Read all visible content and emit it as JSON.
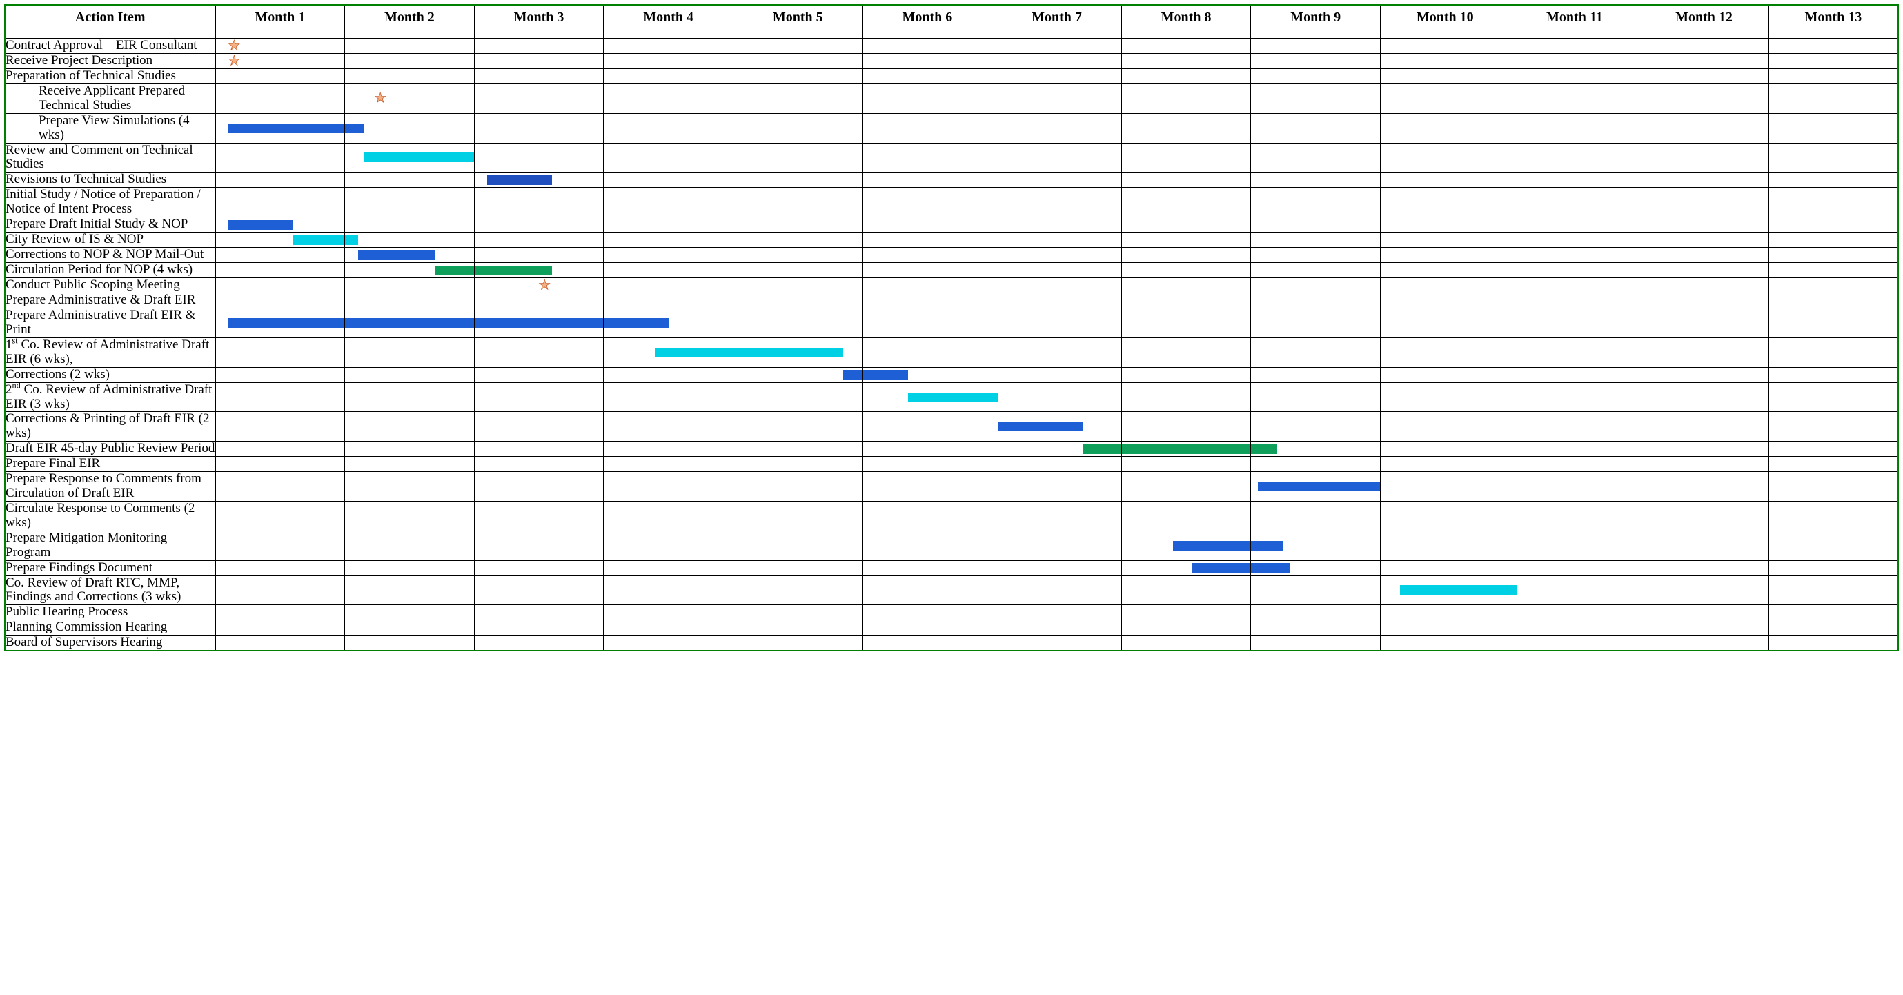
{
  "headers": {
    "action": "Action Item",
    "months": [
      "Month 1",
      "Month 2",
      "Month 3",
      "Month 4",
      "Month 5",
      "Month 6",
      "Month 7",
      "Month 8",
      "Month 9",
      "Month 10",
      "Month 11",
      "Month 12",
      "Month 13"
    ]
  },
  "rows": [
    {
      "label": "Contract Approval – EIR Consultant",
      "indent": false
    },
    {
      "label": "Receive Project Description",
      "indent": false
    },
    {
      "label": "Preparation of Technical Studies",
      "indent": false
    },
    {
      "label": "Receive Applicant Prepared Technical Studies",
      "indent": true
    },
    {
      "label": "Prepare View Simulations (4 wks)",
      "indent": true
    },
    {
      "label": "Review and Comment on Technical Studies",
      "indent": false
    },
    {
      "label": "Revisions to Technical Studies",
      "indent": false
    },
    {
      "label": "Initial Study / Notice of Preparation / Notice of Intent Process",
      "indent": false
    },
    {
      "label": "Prepare Draft Initial Study & NOP",
      "indent": false
    },
    {
      "label": "City Review of IS & NOP",
      "indent": false
    },
    {
      "label": "Corrections to NOP & NOP Mail-Out",
      "indent": false
    },
    {
      "label": "Circulation Period for NOP  (4 wks)",
      "indent": false
    },
    {
      "label": "Conduct Public Scoping Meeting",
      "indent": false
    },
    {
      "label": "Prepare Administrative & Draft EIR",
      "indent": false
    },
    {
      "label": "Prepare Administrative Draft EIR & Print",
      "indent": false
    },
    {
      "label": "1st Co. Review of Administrative Draft EIR (6 wks),",
      "indent": false,
      "sup": "st",
      "pre": "1",
      "post": " Co. Review of Administrative Draft EIR (6 wks),"
    },
    {
      "label": "Corrections (2 wks)",
      "indent": false
    },
    {
      "label": "2nd Co. Review of Administrative Draft EIR (3 wks)",
      "indent": false,
      "sup": "nd",
      "pre": "2",
      "post": " Co. Review of Administrative Draft EIR (3 wks)"
    },
    {
      "label": "Corrections & Printing of Draft EIR (2 wks)",
      "indent": false
    },
    {
      "label": "Draft EIR 45-day Public Review Period",
      "indent": false
    },
    {
      "label": "Prepare Final EIR",
      "indent": false
    },
    {
      "label": "Prepare Response to Comments from Circulation of Draft EIR",
      "indent": false
    },
    {
      "label": "Circulate Response to Comments (2 wks)",
      "indent": false
    },
    {
      "label": "Prepare Mitigation Monitoring Program",
      "indent": false
    },
    {
      "label": "Prepare Findings Document",
      "indent": false
    },
    {
      "label": "Co. Review of Draft RTC, MMP, Findings and Corrections (3 wks)",
      "indent": false
    },
    {
      "label": "Public Hearing Process",
      "indent": false
    },
    {
      "label": "Planning Commission Hearing",
      "indent": false
    },
    {
      "label": "Board of Supervisors Hearing",
      "indent": false
    }
  ],
  "chart_data": {
    "type": "gantt",
    "x_unit": "month",
    "x_range": [
      1,
      13
    ],
    "colors": {
      "blue": "#1e5fd6",
      "cyan": "#00d0e4",
      "green": "#0e9f5a",
      "dblue": "#1f4fbf"
    },
    "stars": [
      {
        "row": 0,
        "month": 1,
        "pos": 0.15
      },
      {
        "row": 1,
        "month": 1,
        "pos": 0.15
      },
      {
        "row": 3,
        "month": 2,
        "pos": 0.28
      },
      {
        "row": 12,
        "month": 3,
        "pos": 0.55
      }
    ],
    "bars": [
      {
        "row": 4,
        "start": 1.1,
        "end": 2.15,
        "color": "blue"
      },
      {
        "row": 5,
        "start": 2.15,
        "end": 3.0,
        "color": "cyan"
      },
      {
        "row": 6,
        "start": 3.1,
        "end": 3.6,
        "color": "dblue"
      },
      {
        "row": 8,
        "start": 1.1,
        "end": 1.6,
        "color": "blue"
      },
      {
        "row": 9,
        "start": 1.6,
        "end": 2.1,
        "color": "cyan"
      },
      {
        "row": 10,
        "start": 2.1,
        "end": 2.7,
        "color": "blue"
      },
      {
        "row": 11,
        "start": 2.7,
        "end": 3.6,
        "color": "green"
      },
      {
        "row": 14,
        "start": 1.1,
        "end": 4.5,
        "color": "blue"
      },
      {
        "row": 15,
        "start": 4.4,
        "end": 5.85,
        "color": "cyan"
      },
      {
        "row": 16,
        "start": 5.85,
        "end": 6.35,
        "color": "blue"
      },
      {
        "row": 17,
        "start": 6.35,
        "end": 7.05,
        "color": "cyan"
      },
      {
        "row": 18,
        "start": 7.05,
        "end": 7.7,
        "color": "blue"
      },
      {
        "row": 19,
        "start": 7.7,
        "end": 9.2,
        "color": "green"
      },
      {
        "row": 21,
        "start": 9.05,
        "end": 10.0,
        "color": "blue"
      },
      {
        "row": 23,
        "start": 8.4,
        "end": 9.25,
        "color": "blue"
      },
      {
        "row": 24,
        "start": 8.55,
        "end": 9.3,
        "color": "blue"
      },
      {
        "row": 25,
        "start": 10.15,
        "end": 11.05,
        "color": "cyan"
      }
    ]
  }
}
